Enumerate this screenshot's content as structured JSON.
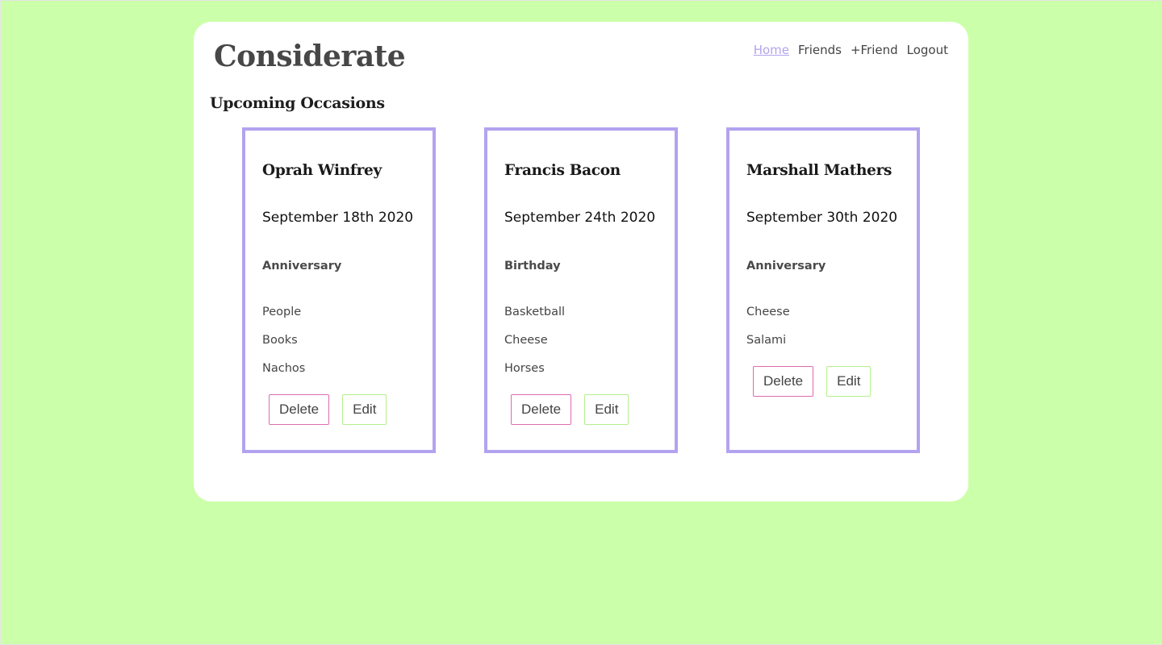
{
  "app": {
    "title": "Considerate"
  },
  "nav": [
    {
      "label": "Home",
      "active": true
    },
    {
      "label": "Friends",
      "active": false
    },
    {
      "label": "+Friend",
      "active": false
    },
    {
      "label": "Logout",
      "active": false
    }
  ],
  "section": {
    "title": "Upcoming Occasions"
  },
  "occasions": [
    {
      "name": "Oprah Winfrey",
      "date": "September 18th 2020",
      "type": "Anniversary",
      "interests": [
        "People",
        "Books",
        "Nachos"
      ],
      "delete_label": "Delete",
      "edit_label": "Edit"
    },
    {
      "name": "Francis Bacon",
      "date": "September 24th 2020",
      "type": "Birthday",
      "interests": [
        "Basketball",
        "Cheese",
        "Horses"
      ],
      "delete_label": "Delete",
      "edit_label": "Edit"
    },
    {
      "name": "Marshall Mathers",
      "date": "September 30th 2020",
      "type": "Anniversary",
      "interests": [
        "Cheese",
        "Salami"
      ],
      "delete_label": "Delete",
      "edit_label": "Edit"
    }
  ],
  "colors": {
    "background": "#ccffaa",
    "card_border": "#b3a3ee",
    "active_link": "#b3a3ee",
    "delete_border": "#dd6bb0",
    "edit_border": "#b4f08c"
  }
}
